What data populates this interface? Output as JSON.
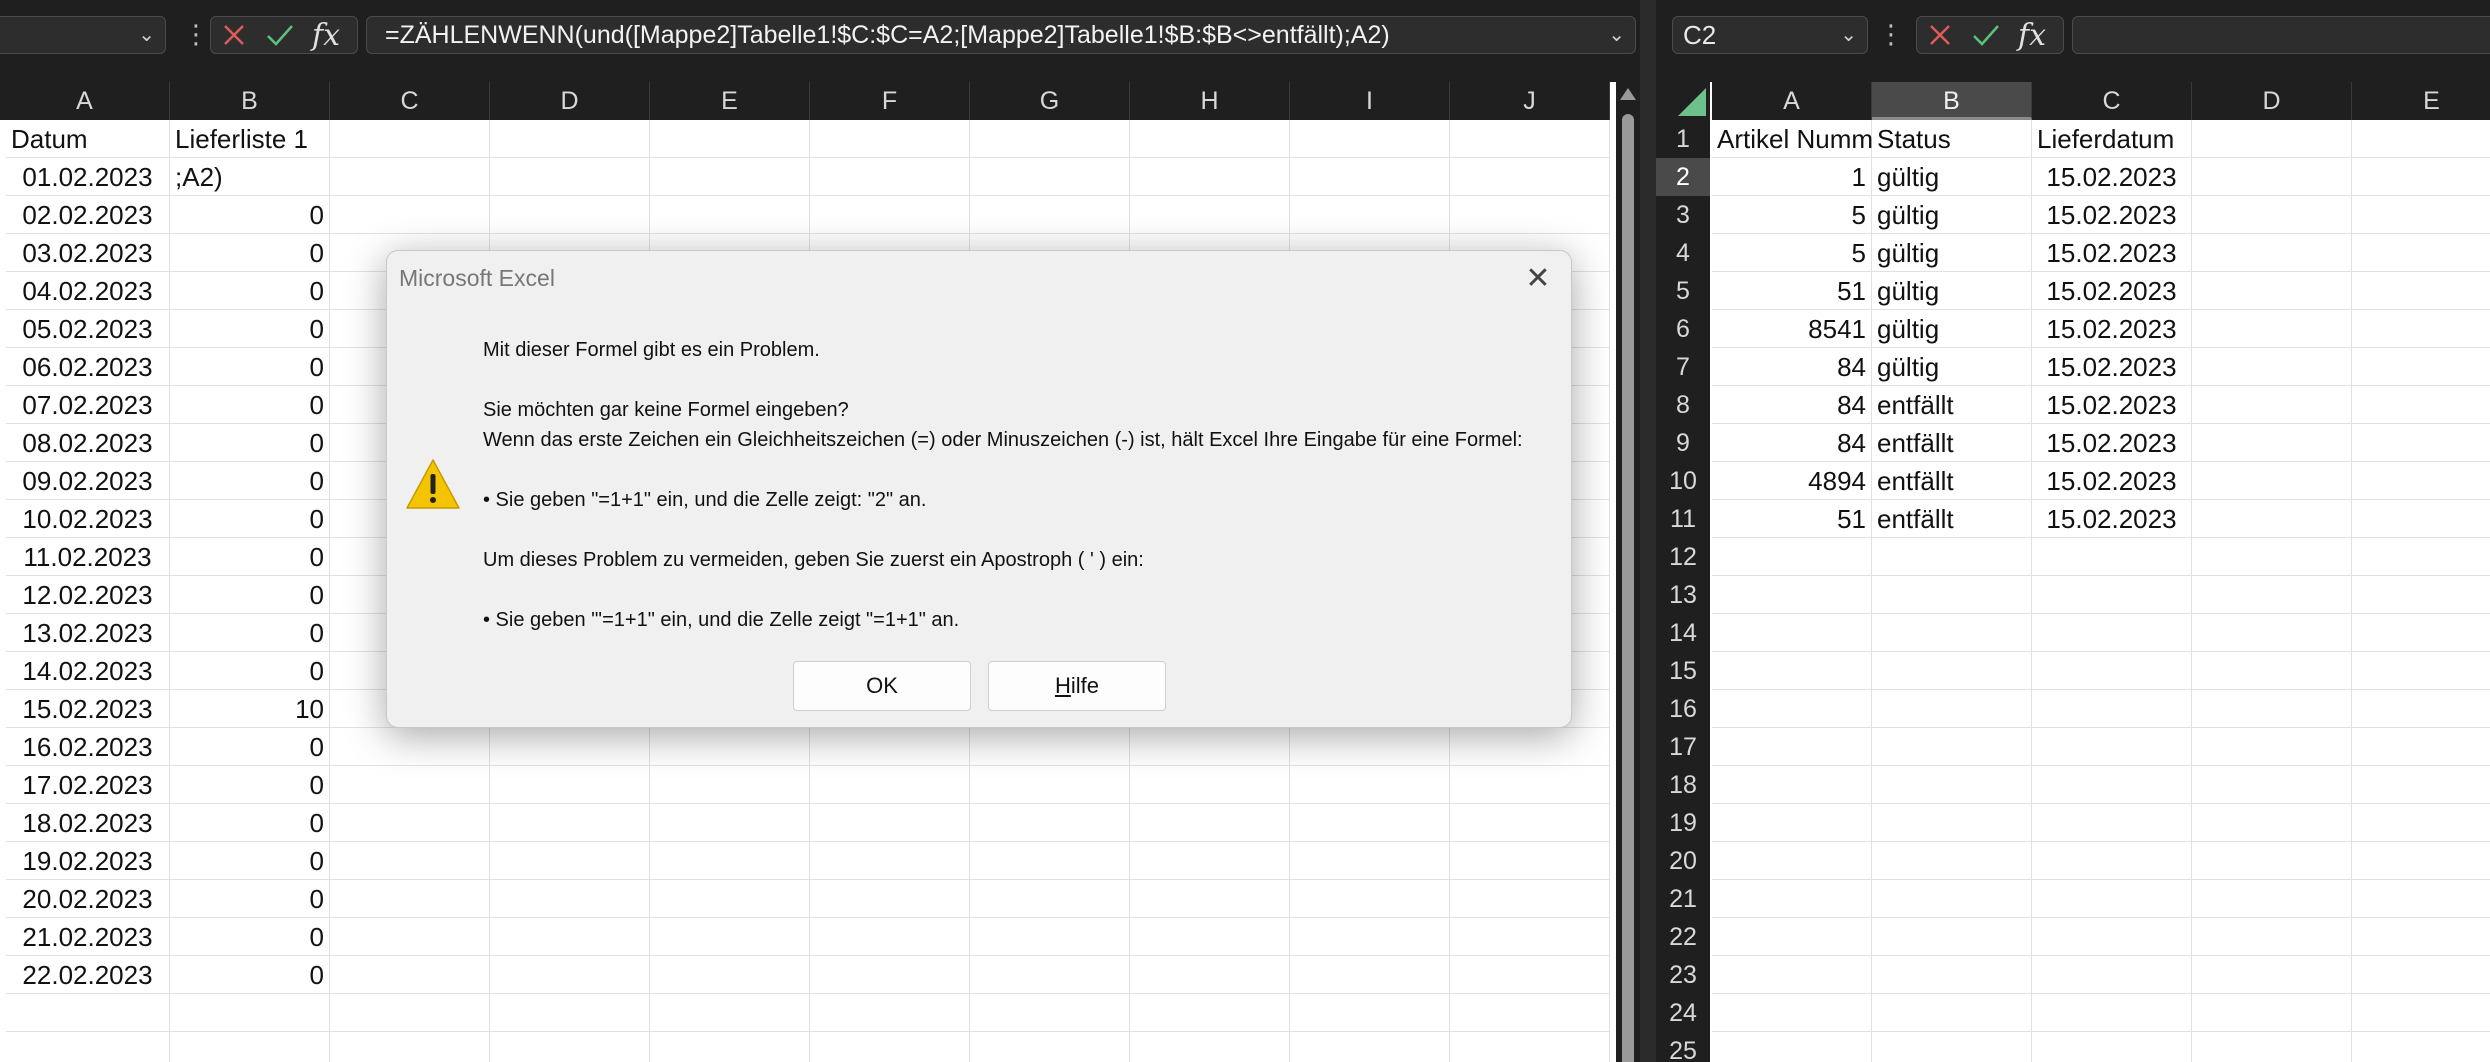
{
  "left": {
    "namebox": "",
    "formula": "=ZÄHLENWENN(und([Mappe2]Tabelle1!$C:$C=A2;[Mappe2]Tabelle1!$B:$B<>entfällt);A2)",
    "columns": [
      "A",
      "B",
      "C",
      "D",
      "E",
      "F",
      "G",
      "H",
      "I",
      "J"
    ],
    "rows": [
      [
        "Datum",
        "Lieferliste 1"
      ],
      [
        "01.02.2023",
        ";A2)"
      ],
      [
        "02.02.2023",
        "0"
      ],
      [
        "03.02.2023",
        "0"
      ],
      [
        "04.02.2023",
        "0"
      ],
      [
        "05.02.2023",
        "0"
      ],
      [
        "06.02.2023",
        "0"
      ],
      [
        "07.02.2023",
        "0"
      ],
      [
        "08.02.2023",
        "0"
      ],
      [
        "09.02.2023",
        "0"
      ],
      [
        "10.02.2023",
        "0"
      ],
      [
        "11.02.2023",
        "0"
      ],
      [
        "12.02.2023",
        "0"
      ],
      [
        "13.02.2023",
        "0"
      ],
      [
        "14.02.2023",
        "0"
      ],
      [
        "15.02.2023",
        "10"
      ],
      [
        "16.02.2023",
        "0"
      ],
      [
        "17.02.2023",
        "0"
      ],
      [
        "18.02.2023",
        "0"
      ],
      [
        "19.02.2023",
        "0"
      ],
      [
        "20.02.2023",
        "0"
      ],
      [
        "21.02.2023",
        "0"
      ],
      [
        "22.02.2023",
        "0"
      ],
      [
        "",
        ""
      ],
      [
        "",
        ""
      ]
    ]
  },
  "right": {
    "namebox": "C2",
    "formula": "",
    "columns": [
      "A",
      "B",
      "C",
      "D",
      "E"
    ],
    "selected_column": "B",
    "selected_row": "2",
    "row_numbers": [
      "1",
      "2",
      "3",
      "4",
      "5",
      "6",
      "7",
      "8",
      "9",
      "10",
      "11",
      "12",
      "13",
      "14",
      "15",
      "16",
      "17",
      "18",
      "19",
      "20",
      "21",
      "22",
      "23",
      "24",
      "25"
    ],
    "rows": [
      [
        "Artikel Numm",
        "Status",
        "Lieferdatum"
      ],
      [
        "1",
        "gültig",
        "15.02.2023"
      ],
      [
        "5",
        "gültig",
        "15.02.2023"
      ],
      [
        "5",
        "gültig",
        "15.02.2023"
      ],
      [
        "51",
        "gültig",
        "15.02.2023"
      ],
      [
        "8541",
        "gültig",
        "15.02.2023"
      ],
      [
        "84",
        "gültig",
        "15.02.2023"
      ],
      [
        "84",
        "entfällt",
        "15.02.2023"
      ],
      [
        "84",
        "entfällt",
        "15.02.2023"
      ],
      [
        "4894",
        "entfällt",
        "15.02.2023"
      ],
      [
        "51",
        "entfällt",
        "15.02.2023"
      ]
    ]
  },
  "dialog": {
    "title": "Microsoft Excel",
    "line1": "Mit dieser Formel gibt es ein Problem.",
    "line2": "Sie möchten gar keine Formel eingeben?",
    "line3": "Wenn das erste Zeichen ein Gleichheitszeichen (=) oder Minuszeichen (-) ist, hält Excel Ihre Eingabe für eine Formel:",
    "line4": "• Sie geben \"=1+1\" ein, und die Zelle zeigt: \"2\" an.",
    "line5": "Um dieses Problem zu vermeiden, geben Sie zuerst ein Apostroph ( ' ) ein:",
    "line6": "• Sie geben \"'=1+1\" ein, und die Zelle zeigt \"=1+1\" an.",
    "ok_label": "OK",
    "help_label": "Hilfe",
    "icon": "warning-icon"
  },
  "colors": {
    "cancel": "#e05a5a",
    "enter": "#5cc27a",
    "warning": "#f5c400",
    "corner": "#6cc28a"
  }
}
